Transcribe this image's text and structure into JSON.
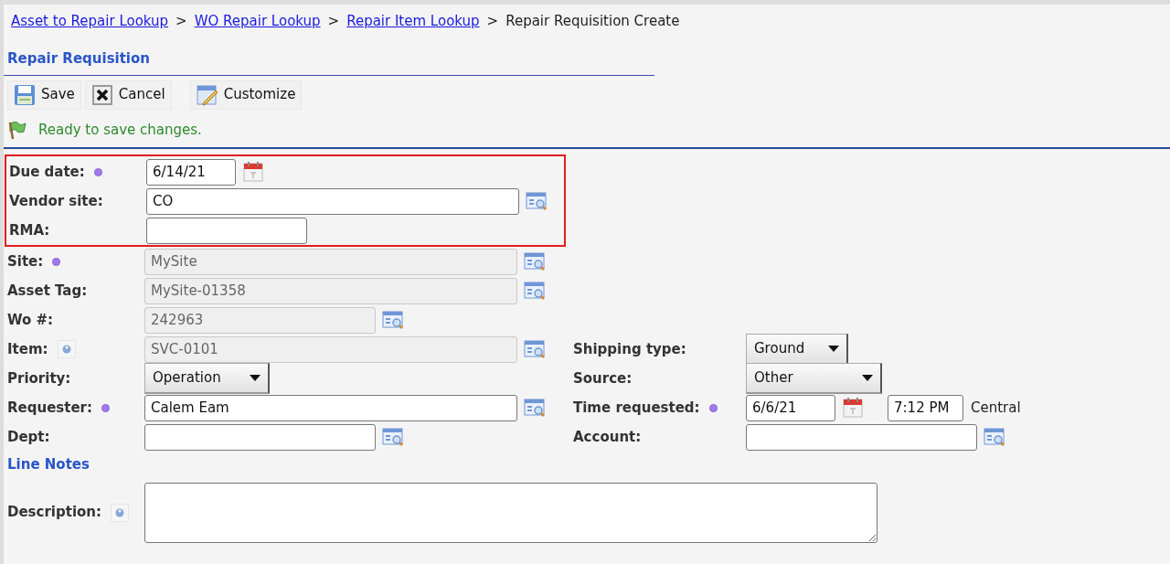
{
  "breadcrumbs": [
    {
      "label": "Asset to Repair Lookup",
      "kind": "link"
    },
    {
      "label": "WO Repair Lookup",
      "kind": "link"
    },
    {
      "label": "Repair Item Lookup",
      "kind": "link"
    },
    {
      "label": "Repair Requisition Create",
      "kind": "current"
    }
  ],
  "breadcrumb_separator": ">",
  "title": "Repair Requisition",
  "toolbar": [
    {
      "label": "Save"
    },
    {
      "label": "Cancel"
    },
    {
      "label": "Customize"
    }
  ],
  "status": "Ready to save changes.",
  "rows": [
    {
      "highlighted": true,
      "left": {
        "label": "Due date:",
        "required": true,
        "kind": "date",
        "value": "6/14/21"
      }
    },
    {
      "highlighted": true,
      "left": {
        "label": "Vendor site:",
        "kind": "lookup",
        "value": "CO"
      }
    },
    {
      "highlighted": true,
      "left": {
        "label": "RMA:",
        "kind": "text"
      }
    },
    {
      "left": {
        "label": "Site:",
        "required": true,
        "kind": "lookup",
        "value": "MySite",
        "disabled": true
      }
    },
    {
      "left": {
        "label": "Asset Tag:",
        "kind": "lookup",
        "value": "MySite-01358",
        "disabled": true
      }
    },
    {
      "left": {
        "label": "Wo #:",
        "kind": "short-lookup",
        "value": "242963",
        "disabled": true
      }
    },
    {
      "left": {
        "label": "Item:",
        "info": true,
        "kind": "lookup",
        "value": "SVC-0101",
        "disabled": true
      },
      "right": {
        "label": "Shipping type:",
        "kind": "select",
        "value": "Ground"
      }
    },
    {
      "left": {
        "label": "Priority:",
        "kind": "select",
        "value": "Operation"
      },
      "right": {
        "label": "Source:",
        "kind": "select-wide",
        "value": "Other"
      }
    },
    {
      "left": {
        "label": "Requester:",
        "required": true,
        "kind": "lookup",
        "value": "Calem Eam"
      },
      "right": {
        "label": "Time requested:",
        "required": true,
        "kind": "datetime",
        "value": "6/6/21",
        "time": "7:12 PM",
        "zone": "Central"
      }
    },
    {
      "left": {
        "label": "Dept:",
        "kind": "short-lookup"
      },
      "right": {
        "label": "Account:",
        "kind": "lookup"
      }
    }
  ],
  "section": "Line Notes",
  "description": {
    "label": "Description:",
    "info": true
  }
}
